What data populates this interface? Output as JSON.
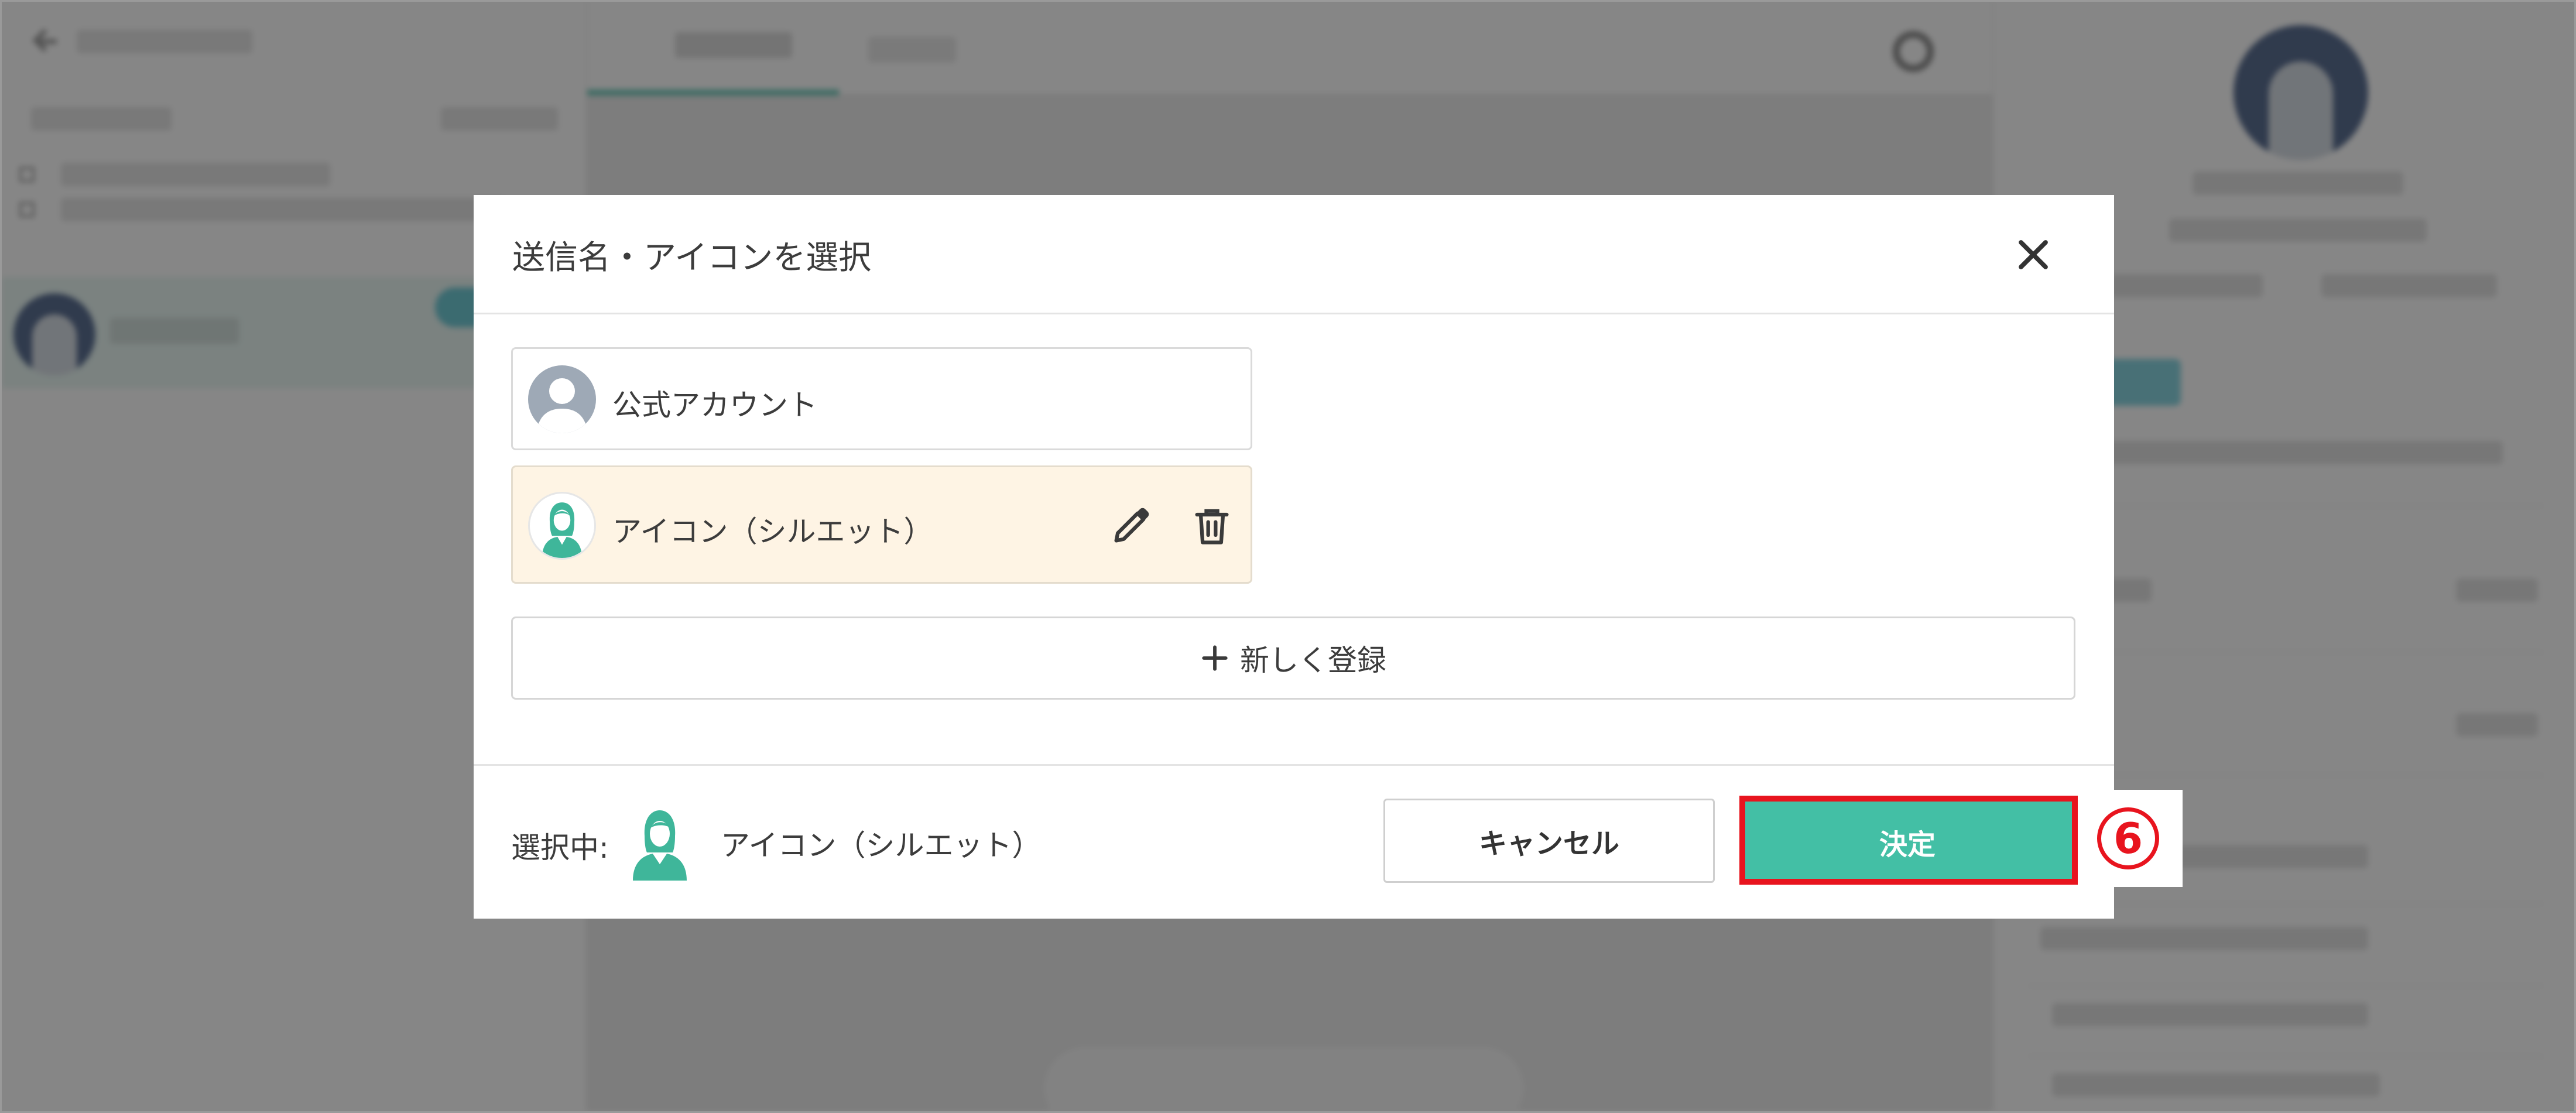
{
  "modal": {
    "title": "送信名・アイコンを選択",
    "accounts": [
      {
        "label": "公式アカウント",
        "icon": "default-user-icon"
      },
      {
        "label": "アイコン（シルエット）",
        "icon": "female-silhouette-icon",
        "selected": true
      }
    ],
    "register_label": "新しく登録",
    "footer": {
      "selected_prefix": "選択中:",
      "selected_name": "アイコン（シルエット）",
      "cancel_label": "キャンセル",
      "confirm_label": "決定"
    }
  },
  "annotation": {
    "step": "6"
  },
  "colors": {
    "accent": "#43bfa5",
    "selected_background": "#fef4e4",
    "highlight": "#e8141e",
    "overlay": "#3c3c3c"
  }
}
